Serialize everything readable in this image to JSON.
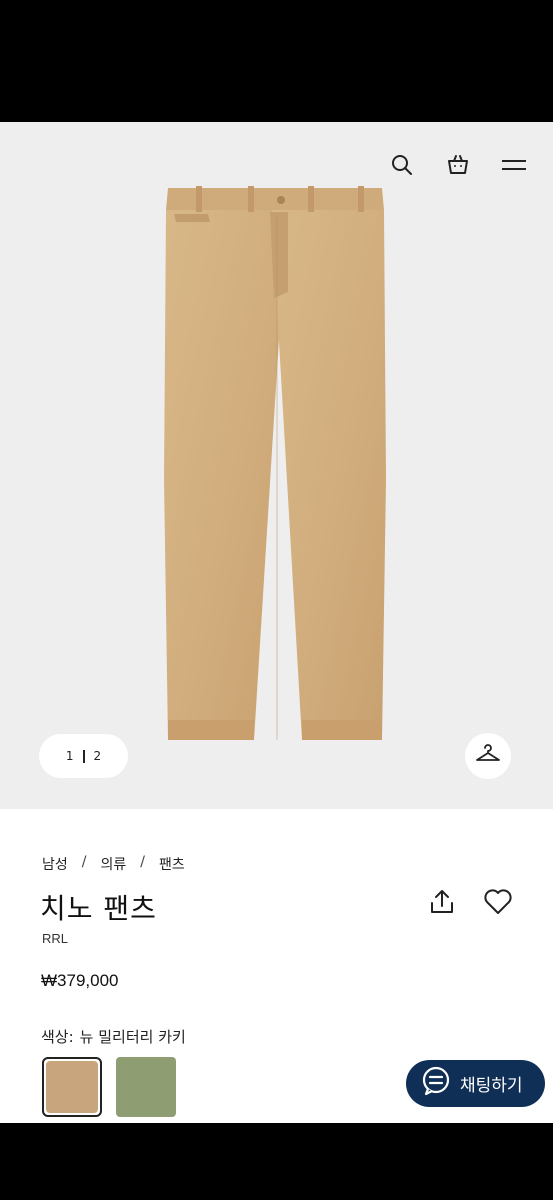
{
  "hero": {
    "pager": {
      "current": "1",
      "total": "2"
    }
  },
  "breadcrumb": [
    "남성",
    "의류",
    "팬츠"
  ],
  "product": {
    "title": "치노 팬츠",
    "brand": "RRL",
    "price": "₩379,000",
    "color_label": "색상:",
    "color_name": "뉴 밀리터리 카키"
  },
  "swatches": [
    {
      "name": "뉴 밀리터리 카키",
      "color": "#c9a57d",
      "selected": true
    },
    {
      "name": "olive",
      "color": "#8e9e72",
      "selected": false
    }
  ],
  "chat": {
    "label": "채팅하기"
  },
  "icons": [
    "search-icon",
    "shopping-bag-icon",
    "menu-icon",
    "hanger-icon",
    "share-icon",
    "heart-icon",
    "chat-icon"
  ]
}
